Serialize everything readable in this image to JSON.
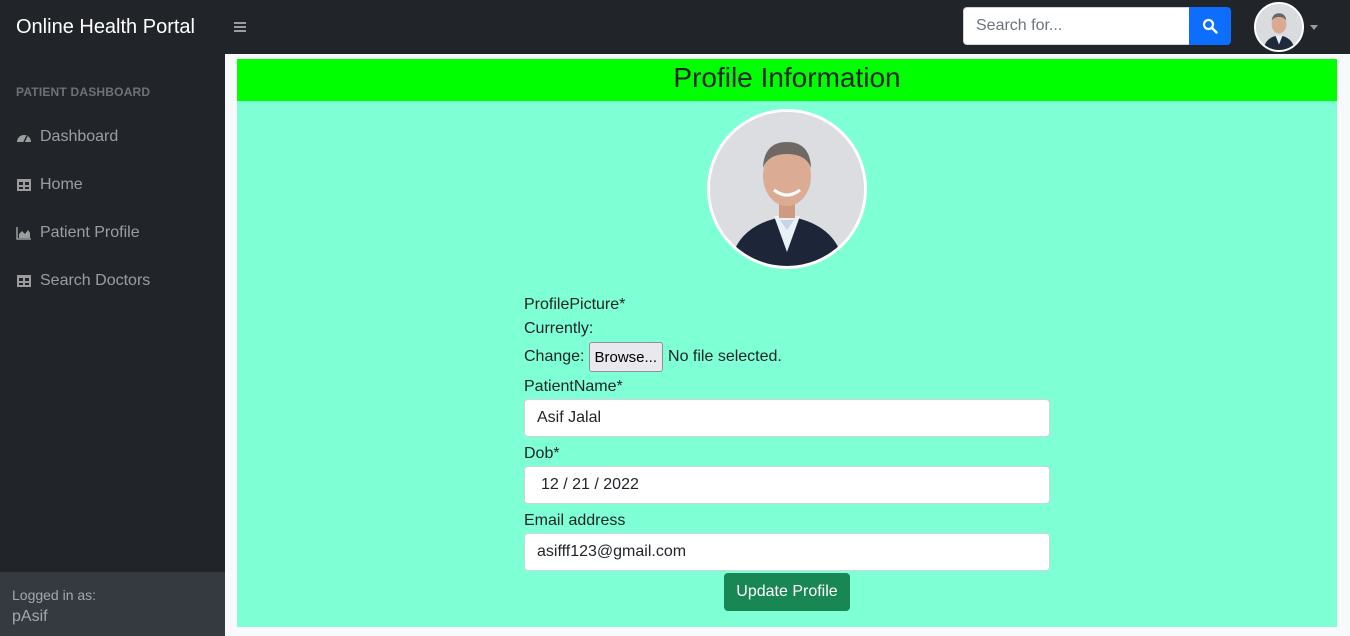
{
  "navbar": {
    "brand": "Online Health Portal",
    "search_placeholder": "Search for..."
  },
  "sidebar": {
    "heading": "PATIENT DASHBOARD",
    "items": [
      {
        "label": "Dashboard",
        "icon": "tachometer-icon"
      },
      {
        "label": "Home",
        "icon": "table-icon"
      },
      {
        "label": "Patient Profile",
        "icon": "area-chart-icon"
      },
      {
        "label": "Search Doctors",
        "icon": "table-icon"
      }
    ],
    "footer_label": "Logged in as:",
    "footer_user": "pAsif"
  },
  "profile": {
    "title": "Profile Information",
    "picture_label": "ProfilePicture*",
    "currently_label": "Currently:",
    "change_label": "Change:",
    "browse_label": "Browse...",
    "no_file_text": "No file selected.",
    "name_label": "PatientName*",
    "name_value": "Asif Jalal",
    "dob_label": "Dob*",
    "dob_value": "12 / 21 / 2022",
    "email_label": "Email address",
    "email_value": "asifff123@gmail.com",
    "submit_label": "Update Profile"
  },
  "colors": {
    "header_bg": "#00ff00",
    "card_bg": "#7fffd4",
    "submit_bg": "#198754",
    "search_btn": "#0d6efd",
    "nav_bg": "#212529"
  }
}
